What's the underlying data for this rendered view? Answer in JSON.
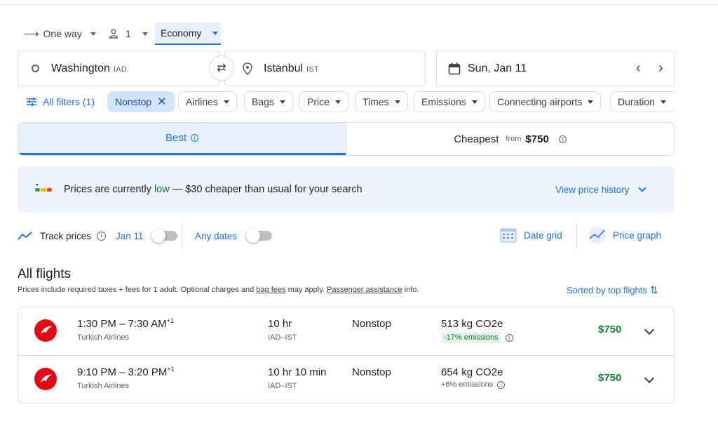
{
  "options": {
    "trip_type": "One way",
    "passengers": "1",
    "cabin_class": "Economy"
  },
  "search": {
    "origin_city": "Washington",
    "origin_code": "IAD",
    "destination_city": "Istanbul",
    "destination_code": "IST",
    "date": "Sun, Jan 11"
  },
  "filters": {
    "all_filters": "All filters (1)",
    "chips": [
      "Nonstop",
      "Airlines",
      "Bags",
      "Price",
      "Times",
      "Emissions",
      "Connecting airports",
      "Duration"
    ]
  },
  "tabs": {
    "best": "Best",
    "cheapest": "Cheapest",
    "cheapest_from": "from",
    "cheapest_price": "$750"
  },
  "insight": {
    "prefix": "Prices are currently",
    "level": "low",
    "suffix": "— $30 cheaper than usual for your search",
    "link": "View price history"
  },
  "track": {
    "label": "Track prices",
    "date": "Jan 11",
    "any_dates": "Any dates",
    "date_grid": "Date grid",
    "price_graph": "Price graph"
  },
  "results_header": {
    "title": "All flights",
    "note_pre": "Prices include required taxes + fees for 1 adult. Optional charges and",
    "bag_fees": "bag fees",
    "note_mid": "may apply.",
    "assistance": "Passenger assistance",
    "note_end": "info.",
    "sort": "Sorted by top flights"
  },
  "flights": [
    {
      "times": "1:30 PM – 7:30 AM",
      "day_offset": "+1",
      "airline": "Turkish Airlines",
      "duration": "10 hr",
      "route": "IAD–IST",
      "stops": "Nonstop",
      "co2": "513 kg CO2e",
      "emissions": "-17% emissions",
      "price": "$750"
    },
    {
      "times": "9:10 PM – 3:20 PM",
      "day_offset": "+1",
      "airline": "Turkish Airlines",
      "duration": "10 hr 10 min",
      "route": "IAD–IST",
      "stops": "Nonstop",
      "co2": "654 kg CO2e",
      "emissions": "+6% emissions",
      "price": "$750"
    }
  ],
  "colors": {
    "accent": "#1a73e8",
    "price_green": "#188038",
    "airline_red": "#e30a17"
  }
}
